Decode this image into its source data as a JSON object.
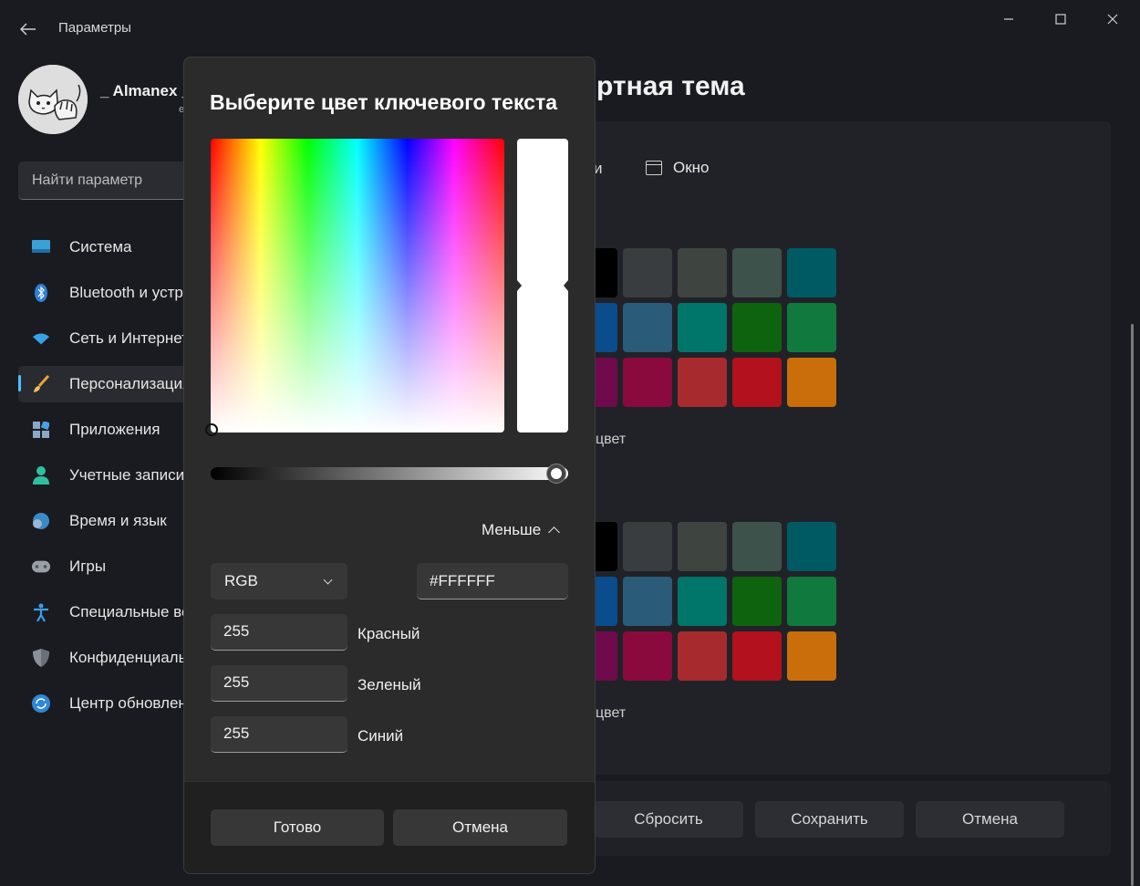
{
  "window": {
    "title": "Параметры",
    "controls": {
      "minimize": "—",
      "maximize": "☐",
      "close": "✕"
    }
  },
  "user": {
    "name": "_ Almanex _",
    "sub": "e"
  },
  "search": {
    "placeholder": "Найти параметр"
  },
  "sidebar": {
    "items": [
      {
        "label": "Система",
        "icon": "display-icon"
      },
      {
        "label": "Bluetooth и устройства",
        "icon": "bluetooth-icon"
      },
      {
        "label": "Сеть и Интернет",
        "icon": "wifi-icon"
      },
      {
        "label": "Персонализация",
        "icon": "brush-icon"
      },
      {
        "label": "Приложения",
        "icon": "apps-icon"
      },
      {
        "label": "Учетные записи",
        "icon": "person-icon"
      },
      {
        "label": "Время и язык",
        "icon": "globe-clock-icon"
      },
      {
        "label": "Игры",
        "icon": "gamepad-icon"
      },
      {
        "label": "Специальные возможности",
        "icon": "accessibility-icon"
      },
      {
        "label": "Конфиденциальность и защита",
        "icon": "shield-icon"
      },
      {
        "label": "Центр обновления Windows",
        "icon": "update-icon"
      }
    ]
  },
  "background": {
    "page_title_fragment": "ртная тема",
    "tab_fragment": "и",
    "tab_window": "Окно",
    "color_label_fragment_1": "цвет",
    "color_label_fragment_2": "цвет",
    "swatches_top": [
      [
        "#000000",
        "#393d3f",
        "#3e4540",
        "#3d524b",
        "#005a64"
      ],
      [
        "#0a4c8c",
        "#2a5b78",
        "#00756a",
        "#0e640e",
        "#107a3e"
      ],
      [
        "#6f0a4c",
        "#8a0a3e",
        "#a72a2f",
        "#b3111d",
        "#c96e0a"
      ]
    ],
    "swatches_bottom": [
      [
        "#000000",
        "#393d3f",
        "#3e4540",
        "#3d524b",
        "#005a64"
      ],
      [
        "#0a4c8c",
        "#2a5b78",
        "#00756a",
        "#0e640e",
        "#107a3e"
      ],
      [
        "#6f0a4c",
        "#8a0a3e",
        "#a72a2f",
        "#b3111d",
        "#c96e0a"
      ]
    ],
    "buttons": {
      "reset": "Сбросить",
      "save": "Сохранить",
      "cancel": "Отмена"
    }
  },
  "dialog": {
    "title": "Выберите цвет ключевого текста",
    "preview_color": "#FFFFFF",
    "value_level": 1.0,
    "less_label": "Меньше",
    "mode": "RGB",
    "hex": "#FFFFFF",
    "red": {
      "value": "255",
      "label": "Красный"
    },
    "green": {
      "value": "255",
      "label": "Зеленый"
    },
    "blue": {
      "value": "255",
      "label": "Синий"
    },
    "done": "Готово",
    "cancel": "Отмена"
  }
}
